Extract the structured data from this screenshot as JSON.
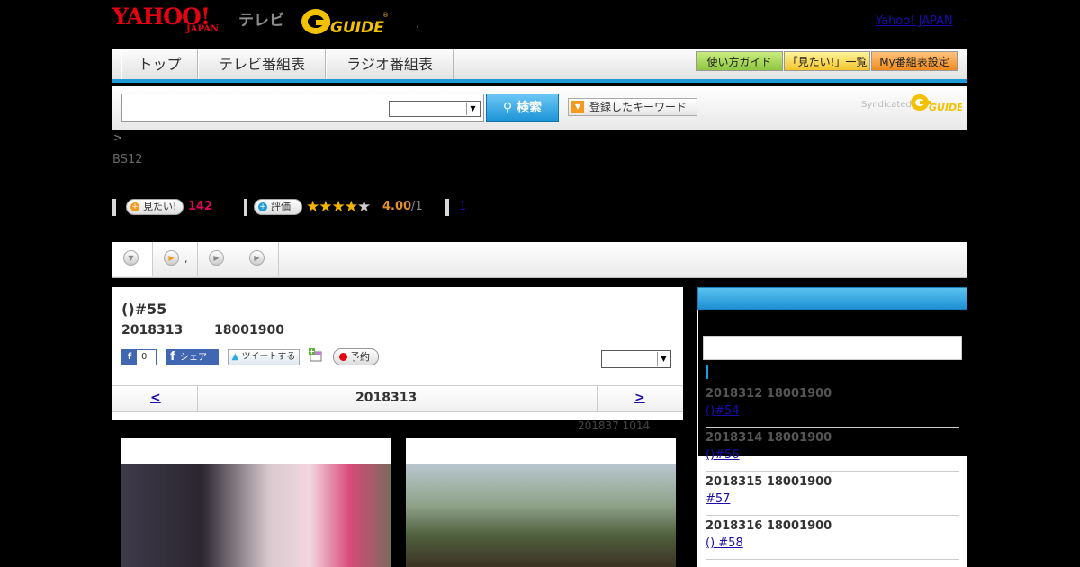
{
  "header": {
    "logo_yahoo": "YAHOO!",
    "logo_japan": "JAPAN",
    "logo_tv": "テレビ",
    "logo_gguide": "G GUIDE",
    "yahoo_japan_link": "Yahoo! JAPAN",
    "sep_dot": ",",
    "sep_dot2": "."
  },
  "nav": {
    "tabs": [
      "トップ",
      "テレビ番組表",
      "ラジオ番組表"
    ],
    "buttons": [
      "使い方ガイド",
      "「見たい!」一覧",
      "My番組表設定"
    ]
  },
  "search": {
    "input_value": "",
    "select_value": "",
    "button_label": "検索",
    "keyword_button": "登録したキーワード",
    "syndicated": "Syndicated",
    "gguide_small": "GUIDE"
  },
  "info": {
    "breadcrumb": ">",
    "channel": "BS12",
    "watch_label": "見たい!",
    "watch_count": "142",
    "rate_label": "評価",
    "rating_stars": 4,
    "rating_max": 5,
    "rating_value": "4.00",
    "rating_count": "/1",
    "review_link": "1"
  },
  "tabs": [
    {
      "label": ""
    },
    {
      "label": ","
    },
    {
      "label": ""
    },
    {
      "label": ""
    }
  ],
  "program": {
    "title": "()#55",
    "date": "2018313",
    "time": "18001900",
    "like_label": "0",
    "share_label": "シェア",
    "tweet_label": "ツイートする",
    "reserve_label": "予約",
    "dropdown_value": "",
    "prev_label": "<",
    "nav_date": "2018313",
    "next_label": ">",
    "updated": "201837  1014"
  },
  "sidebar": {
    "header_title": "",
    "input_value": "",
    "episodes": [
      {
        "date": "2018312  18001900",
        "title": "()#54"
      },
      {
        "date": "2018314  18001900",
        "title": "()#56"
      },
      {
        "date": "2018315  18001900",
        "title": "#57"
      },
      {
        "date": "2018316  18001900",
        "title": "() #58"
      }
    ]
  }
}
